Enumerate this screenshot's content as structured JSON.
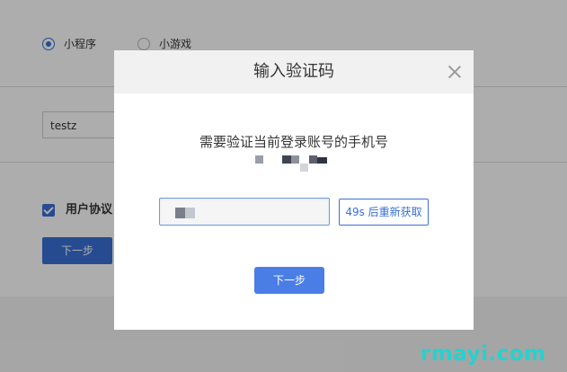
{
  "background": {
    "radio_options": [
      {
        "label": "小程序",
        "checked": true
      },
      {
        "label": "小游戏",
        "checked": false
      }
    ],
    "name_input_value": "testz",
    "agreement_label": "用户协议",
    "next_label": "下一步"
  },
  "modal": {
    "title": "输入验证码",
    "prompt": "需要验证当前登录账号的手机号",
    "resend_label": "49s 后重新获取",
    "next_label": "下一步"
  },
  "watermark": {
    "text": "rmayi.com",
    "color": "#27d1cd"
  },
  "colors": {
    "accent": "#3a6fd6",
    "input_focus_border": "#6d97e5",
    "overlay": "rgba(0,0,0,0.32)"
  }
}
